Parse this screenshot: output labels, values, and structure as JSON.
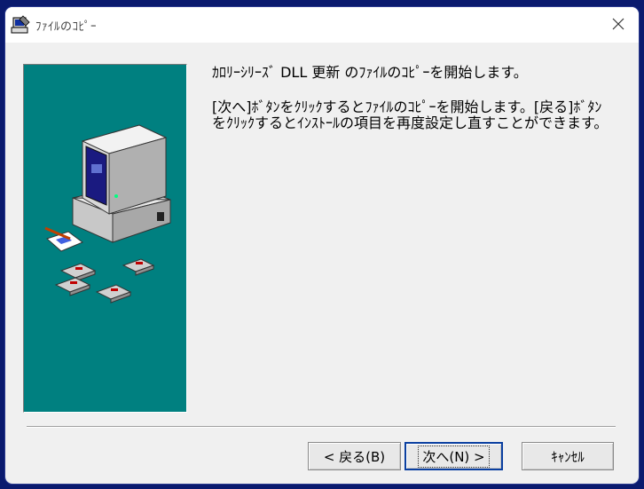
{
  "window": {
    "title": "ﾌｧｲﾙのｺﾋﾟｰ",
    "icon": "setup-icon",
    "close_icon": "close-icon"
  },
  "content": {
    "heading": "ｶﾛﾘｰｼﾘｰｽﾞ DLL 更新 のﾌｧｲﾙのｺﾋﾟｰを開始します。",
    "body": "[次へ]ﾎﾞﾀﾝをｸﾘｯｸするとﾌｧｲﾙのｺﾋﾟｰを開始します。[戻る]ﾎﾞﾀﾝをｸﾘｯｸするとｲﾝｽﾄｰﾙの項目を再度設定し直すことができます。"
  },
  "illustration": {
    "name": "computer-with-disks-illustration",
    "background": "#008080"
  },
  "buttons": {
    "back": "< 戻る(B)",
    "next": "次へ(N) >",
    "cancel": "ｷｬﾝｾﾙ"
  },
  "colors": {
    "panel_bg": "#008080",
    "dialog_bg": "#f0f0f0",
    "focus_border": "#0a3fa0"
  }
}
